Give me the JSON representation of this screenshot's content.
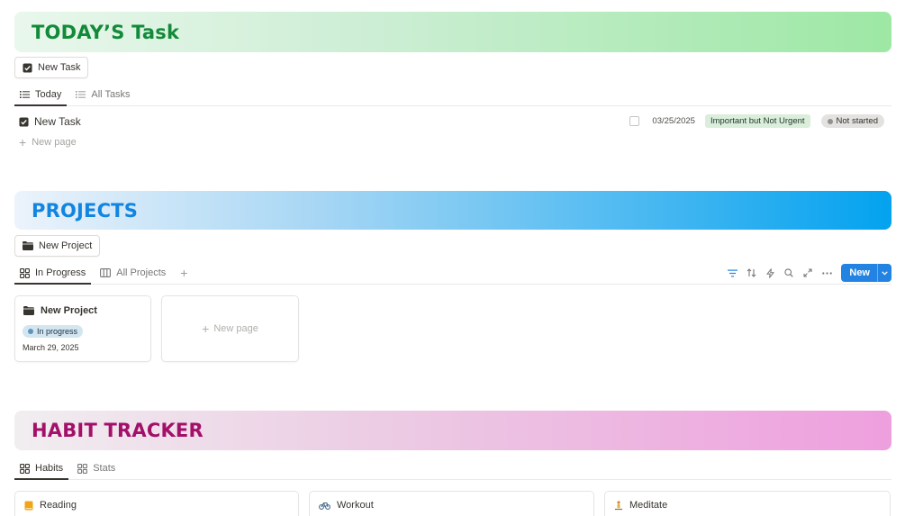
{
  "tasks_section": {
    "banner_title": "TODAY’S Task",
    "new_button": "New Task",
    "tabs": [
      {
        "label": "Today",
        "icon": "list-icon",
        "active": true
      },
      {
        "label": "All Tasks",
        "icon": "list-icon",
        "active": false
      }
    ],
    "rows": [
      {
        "title": "New Task",
        "done": true,
        "date": "03/25/2025",
        "priority": "Important but Not Urgent",
        "status": "Not started"
      }
    ],
    "new_page": "New page"
  },
  "projects_section": {
    "banner_title": "PROJECTS",
    "new_button": "New Project",
    "tabs": [
      {
        "label": "In Progress",
        "icon": "gallery-icon",
        "active": true
      },
      {
        "label": "All Projects",
        "icon": "board-icon",
        "active": false
      }
    ],
    "toolbar": {
      "new_label": "New"
    },
    "cards": [
      {
        "title": "New Project",
        "status": "In progress",
        "date": "March 29, 2025"
      }
    ],
    "new_page": "New page"
  },
  "habits_section": {
    "banner_title": "HABIT TRACKER",
    "tabs": [
      {
        "label": "Habits",
        "icon": "gallery-icon",
        "active": true
      },
      {
        "label": "Stats",
        "icon": "gallery-icon",
        "active": false
      }
    ],
    "cards": [
      {
        "title": "Reading",
        "icon": "book-icon"
      },
      {
        "title": "Workout",
        "icon": "bicycle-icon"
      },
      {
        "title": "Meditate",
        "icon": "meditation-icon"
      }
    ]
  },
  "colors": {
    "accent": "#2383e2",
    "tasks_title": "#138a3a",
    "projects_title": "#1185e0",
    "habits_title": "#a3106a",
    "priority_tag": "#dbeddb",
    "status_tag": "#e3e2e0",
    "progress_tag": "#d3e5ef"
  }
}
